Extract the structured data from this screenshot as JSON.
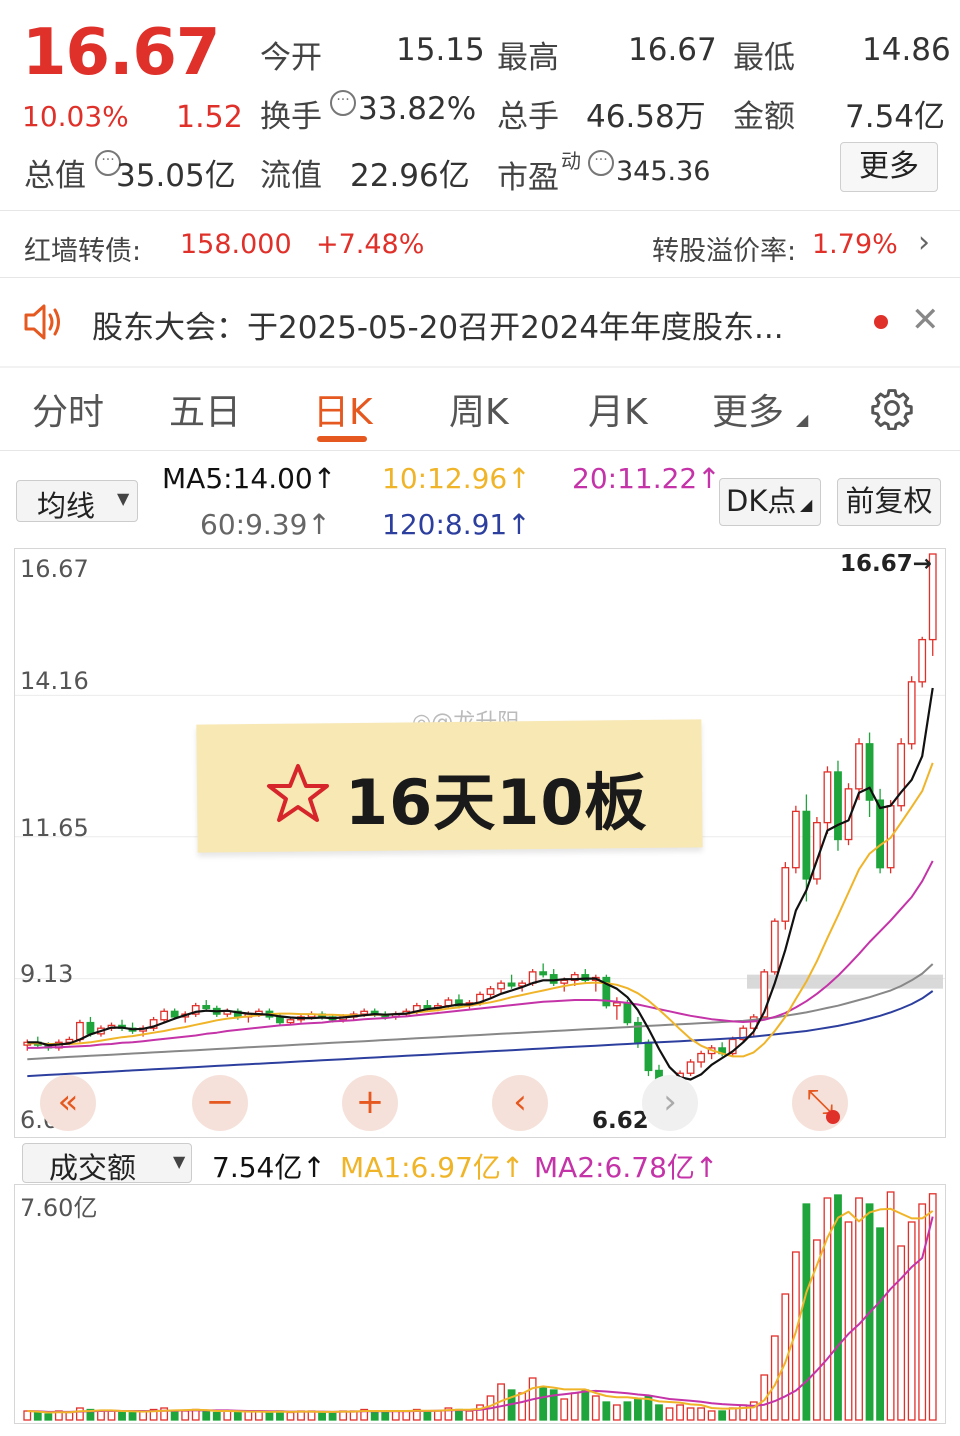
{
  "quote": {
    "price": "16.67",
    "change_pct": "10.03%",
    "change_amt": "1.52",
    "open_label": "今开",
    "open": "15.15",
    "high_label": "最高",
    "high": "16.67",
    "low_label": "最低",
    "low": "14.86",
    "turnover_label": "换手",
    "turnover": "33.82%",
    "volume_label": "总手",
    "volume": "46.58万",
    "amount_label": "金额",
    "amount": "7.54亿",
    "mktcap_label": "总值",
    "mktcap": "35.05亿",
    "float_label": "流值",
    "float_cap": "22.96亿",
    "pe_label": "市盈",
    "pe_sup": "动",
    "pe": "345.36",
    "more_label": "更多"
  },
  "bond": {
    "label": "红墙转债:",
    "price": "158.000",
    "change": "+7.48%",
    "premium_label": "转股溢价率:",
    "premium": "1.79%"
  },
  "notice": {
    "text": "股东大会：于2025-05-20召开2024年年度股东..."
  },
  "tabs": [
    "分时",
    "五日",
    "日K",
    "周K",
    "月K",
    "更多"
  ],
  "ma_bar": {
    "dropdown": "均线",
    "ma5": "MA5:14.00↑",
    "ma10": "10:12.96↑",
    "ma20": "20:11.22↑",
    "ma60": "60:9.39↑",
    "ma120": "120:8.91↑",
    "dk_label": "DK点",
    "adjust_label": "前复权"
  },
  "price_axis": [
    "16.67",
    "14.16",
    "11.65",
    "9.13",
    "6.62"
  ],
  "annotations": {
    "high_marker": "16.67→",
    "low_marker": "6.62→",
    "watermark": "@龙升阳",
    "sticky": "16天10板"
  },
  "volume_bar": {
    "dropdown": "成交额",
    "value": "7.54亿↑",
    "ma1": "MA1:6.97亿↑",
    "ma2": "MA2:6.78亿↑",
    "axis_top": "7.60亿"
  },
  "colors": {
    "up": "#e0302a",
    "down": "#1fa53b",
    "accent": "#e5581f",
    "ma5": "#111111",
    "ma10": "#f0b429",
    "ma20": "#c433a8",
    "ma60": "#888888",
    "ma120": "#2d3f9e"
  },
  "chart_data": {
    "type": "candlestick",
    "ylim": [
      6.62,
      16.67
    ],
    "candles": [
      [
        7.95,
        8.05,
        7.85,
        8.0
      ],
      [
        8.0,
        8.1,
        7.9,
        7.95
      ],
      [
        7.95,
        8.0,
        7.85,
        7.9
      ],
      [
        7.9,
        8.05,
        7.85,
        8.0
      ],
      [
        8.0,
        8.1,
        7.95,
        8.05
      ],
      [
        8.05,
        8.4,
        8.0,
        8.35
      ],
      [
        8.35,
        8.45,
        8.1,
        8.15
      ],
      [
        8.15,
        8.3,
        8.1,
        8.25
      ],
      [
        8.25,
        8.35,
        8.2,
        8.3
      ],
      [
        8.3,
        8.4,
        8.2,
        8.25
      ],
      [
        8.25,
        8.35,
        8.15,
        8.2
      ],
      [
        8.2,
        8.3,
        8.1,
        8.25
      ],
      [
        8.25,
        8.45,
        8.2,
        8.4
      ],
      [
        8.4,
        8.6,
        8.35,
        8.55
      ],
      [
        8.55,
        8.6,
        8.4,
        8.45
      ],
      [
        8.45,
        8.55,
        8.35,
        8.5
      ],
      [
        8.5,
        8.7,
        8.45,
        8.65
      ],
      [
        8.65,
        8.75,
        8.55,
        8.6
      ],
      [
        8.6,
        8.65,
        8.45,
        8.5
      ],
      [
        8.5,
        8.6,
        8.45,
        8.55
      ],
      [
        8.55,
        8.6,
        8.4,
        8.45
      ],
      [
        8.45,
        8.55,
        8.35,
        8.5
      ],
      [
        8.5,
        8.6,
        8.45,
        8.55
      ],
      [
        8.55,
        8.6,
        8.4,
        8.45
      ],
      [
        8.45,
        8.5,
        8.3,
        8.35
      ],
      [
        8.35,
        8.45,
        8.3,
        8.4
      ],
      [
        8.4,
        8.5,
        8.35,
        8.45
      ],
      [
        8.45,
        8.55,
        8.4,
        8.5
      ],
      [
        8.5,
        8.55,
        8.4,
        8.45
      ],
      [
        8.45,
        8.5,
        8.35,
        8.4
      ],
      [
        8.4,
        8.5,
        8.35,
        8.45
      ],
      [
        8.45,
        8.55,
        8.4,
        8.5
      ],
      [
        8.5,
        8.6,
        8.45,
        8.55
      ],
      [
        8.55,
        8.6,
        8.45,
        8.5
      ],
      [
        8.5,
        8.55,
        8.4,
        8.45
      ],
      [
        8.45,
        8.55,
        8.4,
        8.5
      ],
      [
        8.5,
        8.6,
        8.45,
        8.55
      ],
      [
        8.55,
        8.7,
        8.5,
        8.65
      ],
      [
        8.65,
        8.75,
        8.55,
        8.6
      ],
      [
        8.6,
        8.7,
        8.55,
        8.65
      ],
      [
        8.65,
        8.8,
        8.6,
        8.75
      ],
      [
        8.75,
        8.85,
        8.6,
        8.65
      ],
      [
        8.65,
        8.75,
        8.6,
        8.7
      ],
      [
        8.7,
        8.9,
        8.65,
        8.85
      ],
      [
        8.85,
        9.0,
        8.8,
        8.95
      ],
      [
        8.95,
        9.1,
        8.85,
        9.05
      ],
      [
        9.05,
        9.2,
        8.95,
        9.0
      ],
      [
        9.0,
        9.1,
        8.9,
        9.05
      ],
      [
        9.05,
        9.3,
        9.0,
        9.25
      ],
      [
        9.25,
        9.4,
        9.15,
        9.2
      ],
      [
        9.2,
        9.3,
        9.0,
        9.05
      ],
      [
        9.05,
        9.15,
        8.9,
        9.1
      ],
      [
        9.1,
        9.25,
        9.0,
        9.2
      ],
      [
        9.2,
        9.3,
        9.05,
        9.1
      ],
      [
        9.1,
        9.2,
        8.9,
        9.15
      ],
      [
        9.15,
        9.2,
        8.6,
        8.65
      ],
      [
        8.65,
        8.8,
        8.4,
        8.7
      ],
      [
        8.7,
        8.75,
        8.3,
        8.35
      ],
      [
        8.35,
        8.45,
        7.9,
        8.0
      ],
      [
        8.0,
        8.05,
        7.4,
        7.5
      ],
      [
        7.5,
        7.6,
        7.0,
        7.1
      ],
      [
        7.1,
        7.3,
        6.8,
        7.2
      ],
      [
        7.2,
        7.5,
        7.1,
        7.45
      ],
      [
        7.45,
        7.7,
        7.4,
        7.65
      ],
      [
        7.65,
        7.85,
        7.55,
        7.8
      ],
      [
        7.8,
        7.95,
        7.7,
        7.9
      ],
      [
        7.9,
        8.0,
        7.75,
        7.8
      ],
      [
        7.8,
        8.1,
        7.75,
        8.05
      ],
      [
        8.05,
        8.3,
        8.0,
        8.25
      ],
      [
        8.25,
        8.5,
        8.1,
        8.45
      ],
      [
        8.45,
        9.3,
        8.4,
        9.25
      ],
      [
        9.25,
        10.2,
        9.2,
        10.15
      ],
      [
        10.15,
        11.2,
        10.0,
        11.1
      ],
      [
        11.1,
        12.2,
        11.0,
        12.1
      ],
      [
        12.1,
        12.4,
        10.5,
        10.9
      ],
      [
        10.9,
        12.0,
        10.8,
        11.9
      ],
      [
        11.9,
        12.9,
        11.7,
        12.8
      ],
      [
        12.8,
        13.0,
        11.4,
        11.6
      ],
      [
        11.6,
        12.6,
        11.5,
        12.5
      ],
      [
        12.5,
        13.4,
        12.3,
        13.3
      ],
      [
        13.3,
        13.5,
        12.0,
        12.3
      ],
      [
        12.3,
        12.5,
        11.0,
        11.1
      ],
      [
        11.1,
        12.3,
        11.0,
        12.2
      ],
      [
        12.2,
        13.4,
        12.1,
        13.3
      ],
      [
        13.3,
        14.5,
        13.2,
        14.4
      ],
      [
        14.4,
        15.2,
        14.3,
        15.15
      ],
      [
        15.15,
        16.67,
        14.86,
        16.67
      ]
    ],
    "ma5": [
      8.0,
      8.0,
      7.95,
      7.96,
      7.98,
      8.05,
      8.14,
      8.2,
      8.26,
      8.26,
      8.23,
      8.24,
      8.28,
      8.35,
      8.42,
      8.48,
      8.54,
      8.56,
      8.55,
      8.56,
      8.53,
      8.51,
      8.5,
      8.49,
      8.46,
      8.44,
      8.43,
      8.43,
      8.44,
      8.43,
      8.44,
      8.46,
      8.48,
      8.5,
      8.49,
      8.5,
      8.51,
      8.55,
      8.59,
      8.61,
      8.64,
      8.67,
      8.67,
      8.71,
      8.78,
      8.86,
      8.92,
      8.98,
      9.05,
      9.1,
      9.1,
      9.12,
      9.12,
      9.13,
      9.13,
      9.04,
      8.95,
      8.8,
      8.57,
      8.24,
      7.88,
      7.56,
      7.38,
      7.34,
      7.43,
      7.6,
      7.72,
      7.84,
      8.0,
      8.19,
      8.54,
      9.05,
      9.64,
      10.34,
      10.7,
      11.23,
      11.76,
      11.86,
      11.94,
      12.43,
      12.52,
      12.16,
      12.2,
      12.44,
      12.66,
      13.08,
      14.29
    ],
    "ma10": [
      7.98,
      7.98,
      7.97,
      7.97,
      7.97,
      7.98,
      8.0,
      8.03,
      8.06,
      8.09,
      8.11,
      8.14,
      8.17,
      8.2,
      8.24,
      8.27,
      8.31,
      8.35,
      8.39,
      8.42,
      8.44,
      8.46,
      8.48,
      8.5,
      8.51,
      8.51,
      8.5,
      8.5,
      8.49,
      8.49,
      8.48,
      8.48,
      8.48,
      8.49,
      8.49,
      8.5,
      8.51,
      8.53,
      8.55,
      8.57,
      8.6,
      8.62,
      8.65,
      8.68,
      8.71,
      8.75,
      8.8,
      8.84,
      8.88,
      8.92,
      8.96,
      9.0,
      9.03,
      9.05,
      9.06,
      9.05,
      9.02,
      8.96,
      8.87,
      8.74,
      8.58,
      8.41,
      8.23,
      8.06,
      7.94,
      7.86,
      7.8,
      7.75,
      7.75,
      7.82,
      7.98,
      8.2,
      8.45,
      8.77,
      9.08,
      9.44,
      9.85,
      10.25,
      10.66,
      11.07,
      11.35,
      11.5,
      11.63,
      11.9,
      12.18,
      12.46,
      12.96
    ],
    "ma20": [
      7.9,
      7.9,
      7.91,
      7.91,
      7.92,
      7.93,
      7.94,
      7.96,
      7.97,
      7.99,
      8.0,
      8.02,
      8.04,
      8.06,
      8.08,
      8.1,
      8.12,
      8.15,
      8.17,
      8.2,
      8.22,
      8.24,
      8.26,
      8.28,
      8.3,
      8.31,
      8.33,
      8.34,
      8.35,
      8.37,
      8.38,
      8.39,
      8.41,
      8.42,
      8.43,
      8.45,
      8.46,
      8.48,
      8.5,
      8.52,
      8.54,
      8.56,
      8.58,
      8.6,
      8.62,
      8.64,
      8.66,
      8.68,
      8.7,
      8.72,
      8.73,
      8.74,
      8.75,
      8.75,
      8.75,
      8.74,
      8.72,
      8.7,
      8.67,
      8.63,
      8.59,
      8.55,
      8.51,
      8.47,
      8.44,
      8.41,
      8.39,
      8.37,
      8.36,
      8.37,
      8.4,
      8.45,
      8.52,
      8.62,
      8.73,
      8.86,
      9.01,
      9.18,
      9.37,
      9.57,
      9.78,
      9.97,
      10.16,
      10.37,
      10.58,
      10.86,
      11.22
    ],
    "ma60": [
      7.7,
      7.71,
      7.72,
      7.73,
      7.74,
      7.75,
      7.76,
      7.77,
      7.78,
      7.79,
      7.8,
      7.81,
      7.82,
      7.83,
      7.84,
      7.85,
      7.86,
      7.87,
      7.88,
      7.89,
      7.9,
      7.91,
      7.92,
      7.93,
      7.94,
      7.95,
      7.96,
      7.97,
      7.98,
      7.99,
      8.0,
      8.01,
      8.02,
      8.03,
      8.04,
      8.05,
      8.06,
      8.07,
      8.08,
      8.09,
      8.1,
      8.11,
      8.12,
      8.13,
      8.14,
      8.15,
      8.16,
      8.17,
      8.18,
      8.19,
      8.2,
      8.21,
      8.22,
      8.23,
      8.24,
      8.25,
      8.26,
      8.27,
      8.28,
      8.29,
      8.3,
      8.31,
      8.32,
      8.33,
      8.34,
      8.35,
      8.36,
      8.37,
      8.38,
      8.4,
      8.42,
      8.44,
      8.47,
      8.5,
      8.53,
      8.57,
      8.61,
      8.65,
      8.7,
      8.75,
      8.8,
      8.86,
      8.92,
      9.0,
      9.1,
      9.22,
      9.39
    ],
    "ma120": [
      7.4,
      7.41,
      7.42,
      7.43,
      7.44,
      7.45,
      7.46,
      7.47,
      7.48,
      7.49,
      7.5,
      7.51,
      7.52,
      7.53,
      7.54,
      7.55,
      7.56,
      7.57,
      7.58,
      7.59,
      7.6,
      7.61,
      7.62,
      7.63,
      7.64,
      7.65,
      7.66,
      7.67,
      7.68,
      7.69,
      7.7,
      7.71,
      7.72,
      7.73,
      7.74,
      7.75,
      7.76,
      7.77,
      7.78,
      7.79,
      7.8,
      7.81,
      7.82,
      7.83,
      7.84,
      7.85,
      7.86,
      7.87,
      7.88,
      7.89,
      7.9,
      7.91,
      7.92,
      7.93,
      7.94,
      7.95,
      7.96,
      7.97,
      7.98,
      7.99,
      8.0,
      8.01,
      8.02,
      8.03,
      8.04,
      8.05,
      8.06,
      8.07,
      8.08,
      8.1,
      8.12,
      8.14,
      8.16,
      8.18,
      8.2,
      8.23,
      8.26,
      8.29,
      8.33,
      8.37,
      8.42,
      8.47,
      8.53,
      8.6,
      8.68,
      8.78,
      8.91
    ],
    "volume": [
      0.3,
      0.25,
      0.2,
      0.3,
      0.25,
      0.4,
      0.35,
      0.3,
      0.3,
      0.25,
      0.25,
      0.3,
      0.35,
      0.4,
      0.3,
      0.3,
      0.35,
      0.3,
      0.25,
      0.3,
      0.25,
      0.3,
      0.3,
      0.25,
      0.3,
      0.25,
      0.3,
      0.3,
      0.25,
      0.25,
      0.3,
      0.3,
      0.35,
      0.3,
      0.25,
      0.3,
      0.3,
      0.35,
      0.3,
      0.3,
      0.4,
      0.35,
      0.3,
      0.5,
      0.8,
      1.2,
      1.0,
      0.9,
      1.4,
      1.1,
      1.0,
      0.7,
      0.9,
      1.0,
      0.8,
      0.6,
      0.5,
      0.6,
      0.7,
      0.8,
      0.5,
      0.4,
      0.5,
      0.4,
      0.4,
      0.3,
      0.3,
      0.4,
      0.5,
      0.6,
      1.5,
      2.8,
      4.2,
      5.6,
      7.2,
      6.0,
      7.4,
      7.5,
      6.6,
      7.4,
      7.2,
      6.4,
      7.6,
      5.8,
      6.6,
      7.2,
      7.54
    ],
    "vol_ma1": [
      0.3,
      0.28,
      0.25,
      0.26,
      0.26,
      0.29,
      0.3,
      0.32,
      0.32,
      0.3,
      0.29,
      0.28,
      0.29,
      0.31,
      0.32,
      0.33,
      0.34,
      0.33,
      0.3,
      0.3,
      0.29,
      0.28,
      0.28,
      0.27,
      0.28,
      0.27,
      0.28,
      0.28,
      0.27,
      0.27,
      0.28,
      0.28,
      0.3,
      0.3,
      0.3,
      0.3,
      0.3,
      0.31,
      0.31,
      0.31,
      0.33,
      0.34,
      0.34,
      0.37,
      0.47,
      0.63,
      0.76,
      0.88,
      1.06,
      1.12,
      1.08,
      1.02,
      1.02,
      1.02,
      0.9,
      0.8,
      0.76,
      0.76,
      0.72,
      0.7,
      0.62,
      0.6,
      0.58,
      0.52,
      0.5,
      0.4,
      0.38,
      0.38,
      0.4,
      0.42,
      0.66,
      1.16,
      1.92,
      2.94,
      4.26,
      5.16,
      6.08,
      6.74,
      6.94,
      6.62,
      6.92,
      7.02,
      7.04,
      6.88,
      6.72,
      6.72,
      6.97
    ],
    "vol_ma2": [
      0.3,
      0.29,
      0.27,
      0.27,
      0.27,
      0.28,
      0.29,
      0.3,
      0.31,
      0.3,
      0.3,
      0.3,
      0.3,
      0.31,
      0.31,
      0.32,
      0.32,
      0.32,
      0.32,
      0.32,
      0.31,
      0.3,
      0.3,
      0.29,
      0.29,
      0.28,
      0.28,
      0.28,
      0.28,
      0.27,
      0.28,
      0.28,
      0.29,
      0.29,
      0.29,
      0.29,
      0.29,
      0.3,
      0.3,
      0.31,
      0.32,
      0.33,
      0.33,
      0.34,
      0.39,
      0.46,
      0.53,
      0.6,
      0.69,
      0.76,
      0.82,
      0.86,
      0.9,
      0.95,
      0.97,
      0.95,
      0.92,
      0.89,
      0.85,
      0.82,
      0.76,
      0.7,
      0.67,
      0.64,
      0.61,
      0.56,
      0.53,
      0.51,
      0.49,
      0.47,
      0.51,
      0.63,
      0.79,
      0.98,
      1.29,
      1.65,
      2.04,
      2.47,
      2.87,
      3.19,
      3.58,
      3.95,
      4.37,
      4.72,
      5.1,
      5.4,
      6.78
    ]
  }
}
